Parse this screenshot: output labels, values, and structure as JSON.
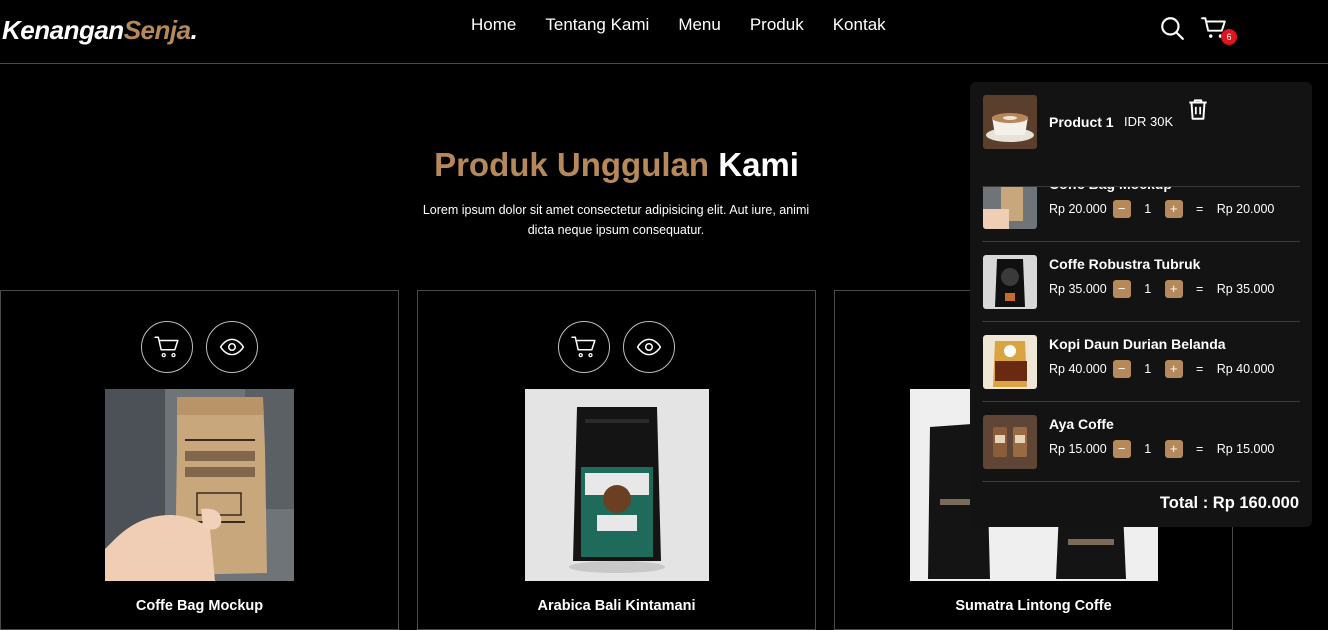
{
  "brand": {
    "name_main": "Kenangan",
    "name_accent": "Senja",
    "dot": "."
  },
  "nav": {
    "links": [
      "Home",
      "Tentang Kami",
      "Menu",
      "Produk",
      "Kontak"
    ],
    "cart_count": "6"
  },
  "section": {
    "title_accent": "Produk Unggulan",
    "title_main": "Kami",
    "description": "Lorem ipsum dolor sit amet consectetur adipisicing elit. Aut iure, animi dicta neque ipsum consequatur."
  },
  "products": [
    {
      "name": "Coffe Bag Mockup",
      "icon": "cart-icon"
    },
    {
      "name": "Arabica Bali Kintamani",
      "icon": "cart-icon"
    },
    {
      "name": "Sumatra Lintong Coffe",
      "icon": "cart-icon"
    }
  ],
  "cart": {
    "first_item": {
      "name": "Product 1",
      "price": "IDR 30K"
    },
    "partial_item_name": "Coffe Bag Mockup",
    "items": [
      {
        "name": "Coffe Bag Mockup",
        "price": "Rp 20.000",
        "qty": "1",
        "subtotal": "Rp 20.000"
      },
      {
        "name": "Coffe Robustra Tubruk",
        "price": "Rp 35.000",
        "qty": "1",
        "subtotal": "Rp 35.000"
      },
      {
        "name": "Kopi Daun Durian Belanda",
        "price": "Rp 40.000",
        "qty": "1",
        "subtotal": "Rp 40.000"
      },
      {
        "name": "Aya Coffe",
        "price": "Rp 15.000",
        "qty": "1",
        "subtotal": "Rp 15.000"
      }
    ],
    "minus": "−",
    "plus": "+",
    "equals": "=",
    "total": "Total : Rp 160.000"
  },
  "colors": {
    "accent": "#b6895b",
    "badge": "#e0141e",
    "panel": "#131313"
  }
}
